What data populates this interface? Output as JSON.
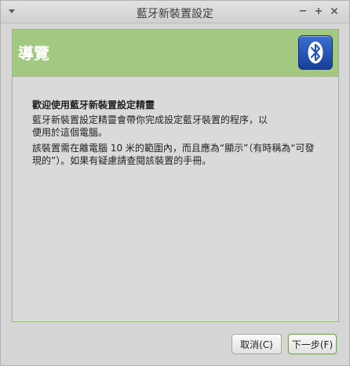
{
  "window": {
    "title": "藍牙新裝置設定"
  },
  "header": {
    "title": "導覽",
    "icon": "bluetooth-icon"
  },
  "content": {
    "heading": "歡迎使用藍牙新裝置設定精靈",
    "paragraph1": "藍牙新裝置設定精靈會帶你完成設定藍牙裝置的程序，以便用於這個電腦。",
    "paragraph2": "該裝置需在離電腦 10 米的範圍內，而且應為“顯示”（有時稱為“可發現的”）。如果有疑慮請查閱該裝置的手冊。"
  },
  "buttons": {
    "cancel_label": "取消(C)",
    "next_label": "下一步(F)"
  },
  "colors": {
    "header_green": "#a3c882",
    "bluetooth_blue": "#2a56b8"
  }
}
